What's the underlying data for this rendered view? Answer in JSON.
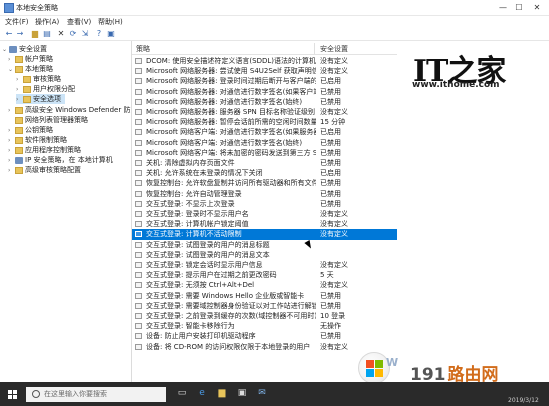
{
  "window": {
    "title": "本地安全策略",
    "controls": {
      "minimize": "—",
      "maximize": "☐",
      "close": "✕"
    }
  },
  "menu": [
    "文件(F)",
    "操作(A)",
    "查看(V)",
    "帮助(H)"
  ],
  "toolbar_icons": [
    "back-arrow-icon",
    "forward-arrow-icon",
    "up-folder-icon",
    "properties-icon",
    "delete-icon",
    "refresh-icon",
    "export-icon",
    "help-icon",
    "console-icon"
  ],
  "tree": {
    "items": [
      {
        "label": "安全设置",
        "expander": "⌄",
        "indent": 0,
        "icon": "shield"
      },
      {
        "label": "帐户策略",
        "expander": "›",
        "indent": 1,
        "icon": "folder"
      },
      {
        "label": "本地策略",
        "expander": "⌄",
        "indent": 1,
        "icon": "folder"
      },
      {
        "label": "审核策略",
        "expander": "›",
        "indent": 2,
        "icon": "folder"
      },
      {
        "label": "用户权限分配",
        "expander": "›",
        "indent": 2,
        "icon": "folder"
      },
      {
        "label": "安全选项",
        "expander": "›",
        "indent": 2,
        "icon": "folder",
        "selected": true
      },
      {
        "label": "高级安全 Windows Defender 防火",
        "expander": "›",
        "indent": 1,
        "icon": "folder"
      },
      {
        "label": "网络列表管理器策略",
        "expander": "",
        "indent": 1,
        "icon": "folder"
      },
      {
        "label": "公钥策略",
        "expander": "›",
        "indent": 1,
        "icon": "folder"
      },
      {
        "label": "软件限制策略",
        "expander": "›",
        "indent": 1,
        "icon": "folder"
      },
      {
        "label": "应用程序控制策略",
        "expander": "›",
        "indent": 1,
        "icon": "folder"
      },
      {
        "label": "IP 安全策略，在 本地计算机",
        "expander": "›",
        "indent": 1,
        "icon": "shield"
      },
      {
        "label": "高级审核策略配置",
        "expander": "›",
        "indent": 1,
        "icon": "folder"
      }
    ]
  },
  "list": {
    "columns": [
      "策略",
      "安全设置"
    ],
    "rows": [
      {
        "name": "DCOM: 使用安全描述符定义语言(SDDL)语法的计算机启动...",
        "value": "没有定义"
      },
      {
        "name": "Microsoft 网络服务器: 尝试使用 S4U2Self 获取声明信息",
        "value": "没有定义"
      },
      {
        "name": "Microsoft 网络服务器: 登录时间过期后断开与客户端的连接",
        "value": "已启用"
      },
      {
        "name": "Microsoft 网络服务器: 对通信进行数字签名(如果客户端允...",
        "value": "已禁用"
      },
      {
        "name": "Microsoft 网络服务器: 对通信进行数字签名(始终)",
        "value": "已禁用"
      },
      {
        "name": "Microsoft 网络服务器: 服务器 SPN 目标名称验证级别",
        "value": "没有定义"
      },
      {
        "name": "Microsoft 网络服务器: 暂停会话前所需的空闲时间数量",
        "value": "15 分钟"
      },
      {
        "name": "Microsoft 网络客户端: 对通信进行数字签名(如果服务器允...",
        "value": "已启用"
      },
      {
        "name": "Microsoft 网络客户端: 对通信进行数字签名(始终)",
        "value": "已禁用"
      },
      {
        "name": "Microsoft 网络客户端: 将未加密的密码发送到第三方 SMB...",
        "value": "已禁用"
      },
      {
        "name": "关机: 清除虚拟内存页面文件",
        "value": "已禁用"
      },
      {
        "name": "关机: 允许系统在未登录的情况下关闭",
        "value": "已启用"
      },
      {
        "name": "恢复控制台: 允许软盘复制并访问所有驱动器和所有文件夹",
        "value": "已禁用"
      },
      {
        "name": "恢复控制台: 允许自动管理登录",
        "value": "已禁用"
      },
      {
        "name": "交互式登录: 不显示上次登录",
        "value": "已禁用"
      },
      {
        "name": "交互式登录: 登录时不显示用户名",
        "value": "没有定义"
      },
      {
        "name": "交互式登录: 计算机帐户锁定阈值",
        "value": "没有定义"
      },
      {
        "name": "交互式登录: 计算机不活动限制",
        "value": "没有定义",
        "highlight": true
      },
      {
        "name": "交互式登录: 试图登录的用户的消息标题",
        "value": ""
      },
      {
        "name": "交互式登录: 试图登录的用户的消息文本",
        "value": ""
      },
      {
        "name": "交互式登录: 锁定会话时显示用户信息",
        "value": "没有定义"
      },
      {
        "name": "交互式登录: 提示用户在过期之前更改密码",
        "value": "5 天"
      },
      {
        "name": "交互式登录: 无须按 Ctrl+Alt+Del",
        "value": "没有定义"
      },
      {
        "name": "交互式登录: 需要 Windows Hello 企业版或智能卡",
        "value": "已禁用"
      },
      {
        "name": "交互式登录: 需要域控制器身份验证以对工作站进行解锁",
        "value": "已禁用"
      },
      {
        "name": "交互式登录: 之前登录到缓存的次数(域控制器不可用时)",
        "value": "10 登录"
      },
      {
        "name": "交互式登录: 智能卡移除行为",
        "value": "无操作"
      },
      {
        "name": "设备: 防止用户安装打印机驱动程序",
        "value": "已禁用"
      },
      {
        "name": "设备: 将 CD-ROM 的访问权限仅限于本地登录的用户",
        "value": "没有定义"
      }
    ]
  },
  "overlay": {
    "logo_text": "IT之家",
    "logo_url": "www.ithome.com",
    "watermark": "191路由网",
    "watermark_prefix": "191",
    "watermark_suffix": "路由网",
    "wtext": "W"
  },
  "taskbar": {
    "search_placeholder": "在这里输入你要搜索",
    "clock": "2019/3/12"
  }
}
